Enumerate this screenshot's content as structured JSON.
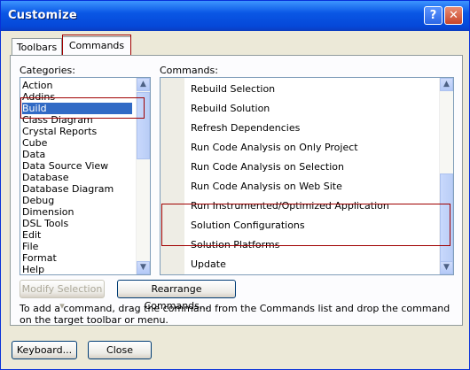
{
  "window": {
    "title": "Customize",
    "help_glyph": "?",
    "close_glyph": "✕"
  },
  "tabs": [
    {
      "label": "Toolbars"
    },
    {
      "label": "Commands"
    }
  ],
  "categories": {
    "label": "Categories:",
    "items": [
      "Action",
      "Addins",
      "Build",
      "Class Diagram",
      "Crystal Reports",
      "Cube",
      "Data",
      "Data Source View",
      "Database",
      "Database Diagram",
      "Debug",
      "Dimension",
      "DSL Tools",
      "Edit",
      "File",
      "Format",
      "Help"
    ],
    "selected": "Build"
  },
  "commands": {
    "label": "Commands:",
    "items": [
      "Rebuild Selection",
      "Rebuild Solution",
      "Refresh Dependencies",
      "Run Code Analysis on Only Project",
      "Run Code Analysis on Selection",
      "Run Code Analysis on Web Site",
      "Run Instrumented/Optimized Application",
      "Solution Configurations",
      "Solution Platforms",
      "Update"
    ],
    "selected": "Solution Configurations",
    "combo_value": ""
  },
  "buttons": {
    "modify_selection": "Modify Selection ▾",
    "rearrange": "Rearrange Commands...",
    "keyboard": "Keyboard...",
    "close": "Close"
  },
  "instructions": "To add a command, drag the command from the Commands list and drop the command on the target toolbar or menu.",
  "colors": {
    "titlebar": "#0a57e5",
    "selection": "#316ac5",
    "highlight_box": "#a00000"
  }
}
